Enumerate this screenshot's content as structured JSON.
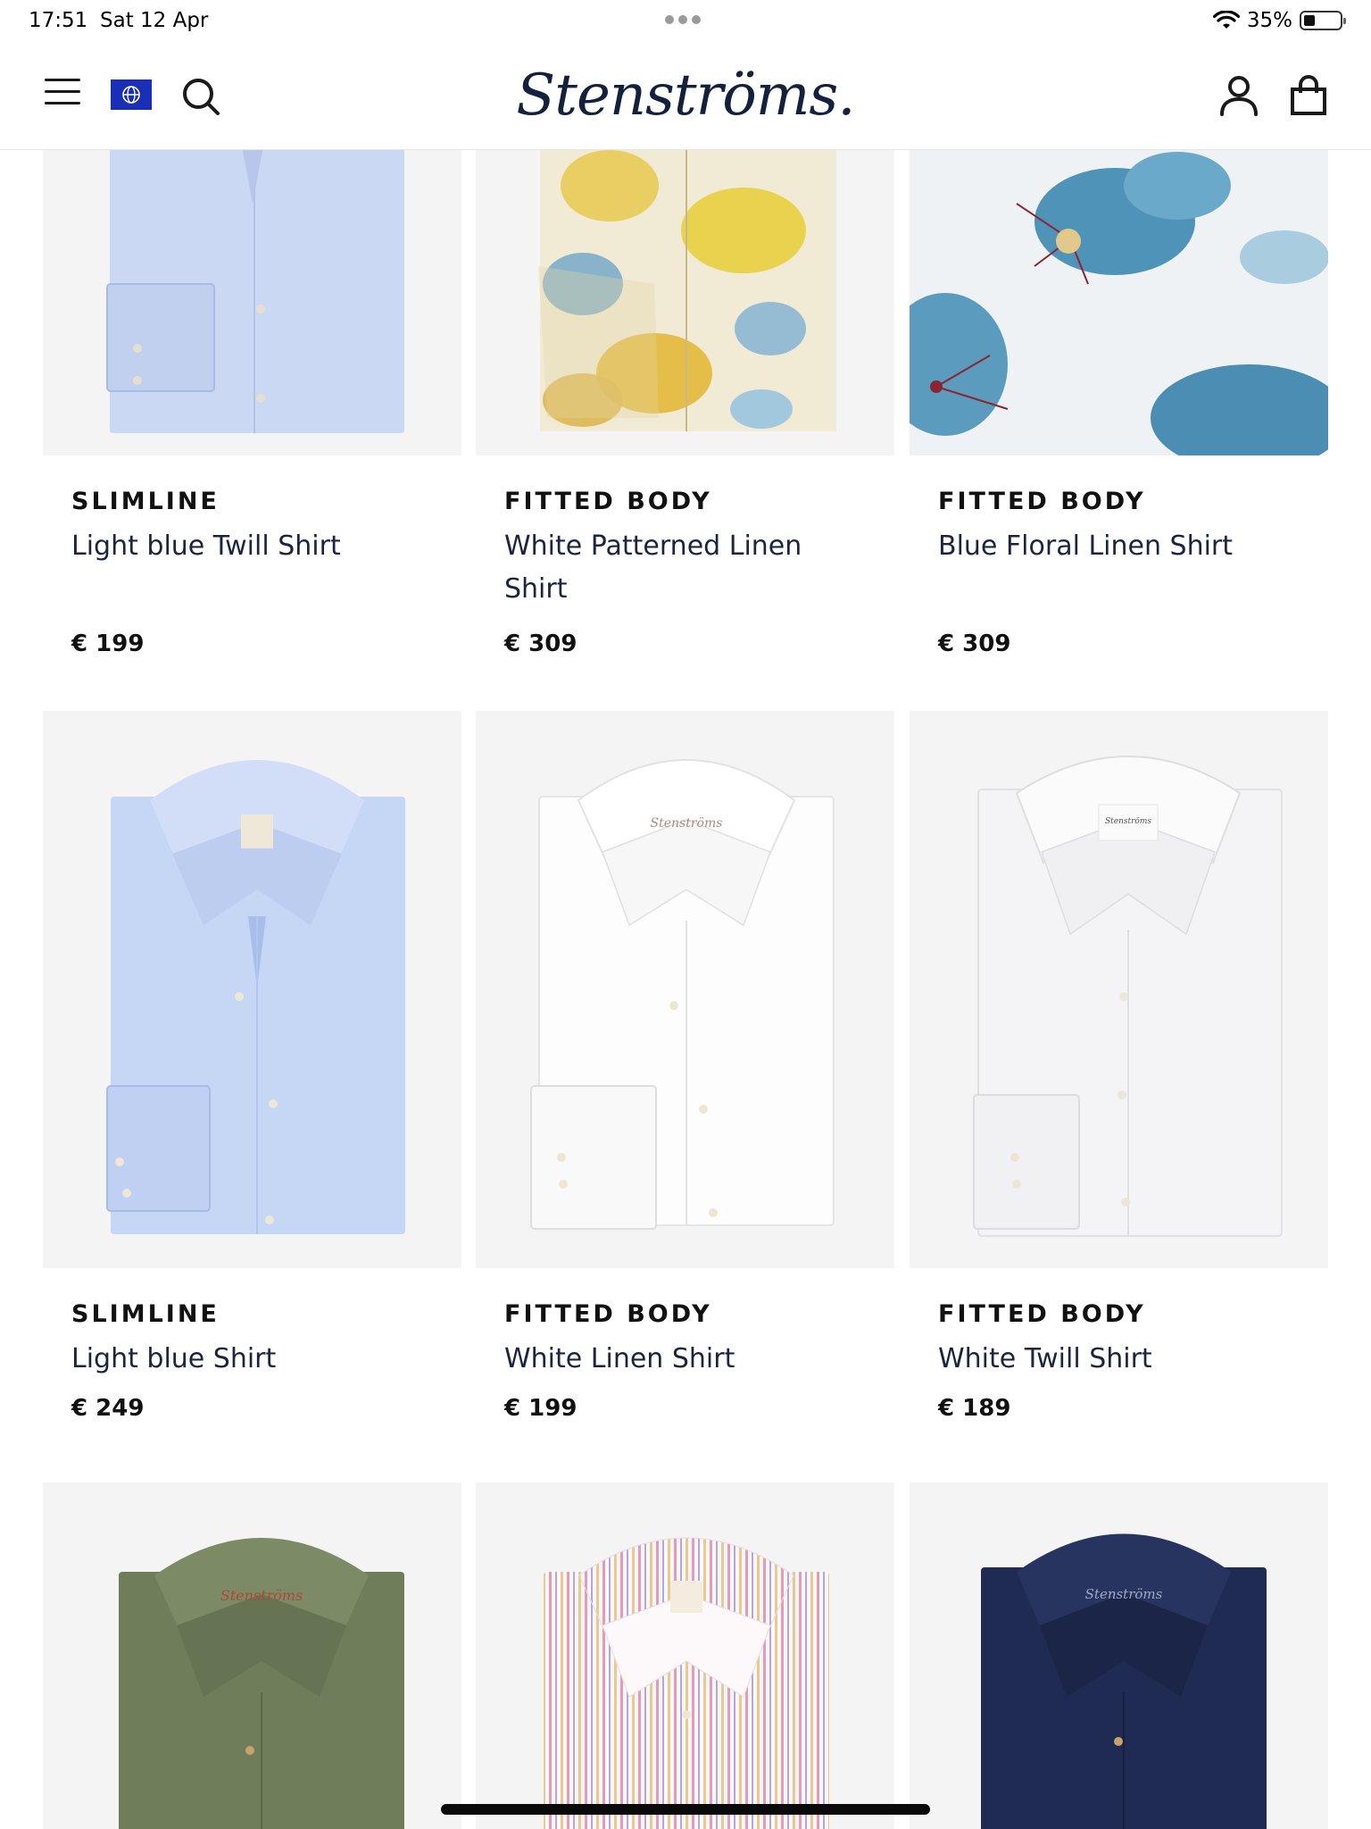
{
  "status": {
    "time": "17:51",
    "date": "Sat 12 Apr",
    "battery": "35%",
    "battery_level": 0.35
  },
  "header": {
    "brand": "Stenströms.",
    "icons": [
      "menu-icon",
      "globe-flag-icon",
      "search-icon",
      "account-icon",
      "shopping-bag-icon"
    ]
  },
  "products": [
    {
      "fit": "SLIMLINE",
      "name": "Light blue Twill Shirt",
      "price": "€ 199",
      "color": "#c9d6f2"
    },
    {
      "fit": "FITTED BODY",
      "name": "White Patterned Linen Shirt",
      "price": "€ 309",
      "color": "#e9d48a"
    },
    {
      "fit": "FITTED BODY",
      "name": "Blue Floral Linen Shirt",
      "price": "€ 309",
      "color": "#4f90b4"
    },
    {
      "fit": "SLIMLINE",
      "name": "Light blue Shirt",
      "price": "€ 249",
      "color": "#c5d5f4"
    },
    {
      "fit": "FITTED BODY",
      "name": "White Linen Shirt",
      "price": "€ 199",
      "color": "#fafafa"
    },
    {
      "fit": "FITTED BODY",
      "name": "White Twill Shirt",
      "price": "€ 189",
      "color": "#f3f3f5"
    },
    {
      "color": "#6f7d5a"
    },
    {
      "color": "#f3dde6"
    },
    {
      "color": "#1f2b52"
    }
  ]
}
